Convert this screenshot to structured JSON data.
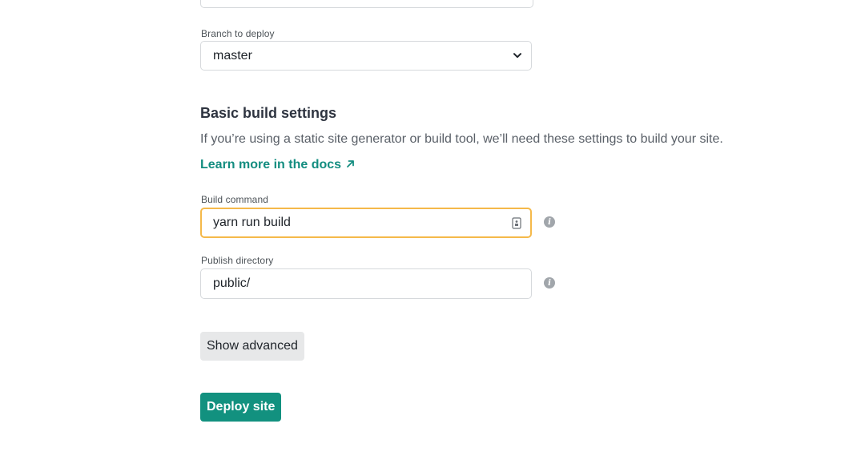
{
  "branch": {
    "label": "Branch to deploy",
    "value": "master"
  },
  "build_settings": {
    "title": "Basic build settings",
    "description": "If you’re using a static site generator or build tool, we’ll need these settings to build your site.",
    "docs_link": "Learn more in the docs",
    "docs_link_icon": "external-arrow-icon"
  },
  "build_command": {
    "label": "Build command",
    "value": "yarn run build",
    "focused": true,
    "info_icon": "info-icon"
  },
  "publish_directory": {
    "label": "Publish directory",
    "value": "public/",
    "info_icon": "info-icon"
  },
  "actions": {
    "show_advanced": "Show advanced",
    "deploy": "Deploy site"
  },
  "colors": {
    "accent": "#12917f",
    "link": "#138d80",
    "focus_border": "#f5b94a",
    "secondary_button": "#e7e8e9"
  }
}
